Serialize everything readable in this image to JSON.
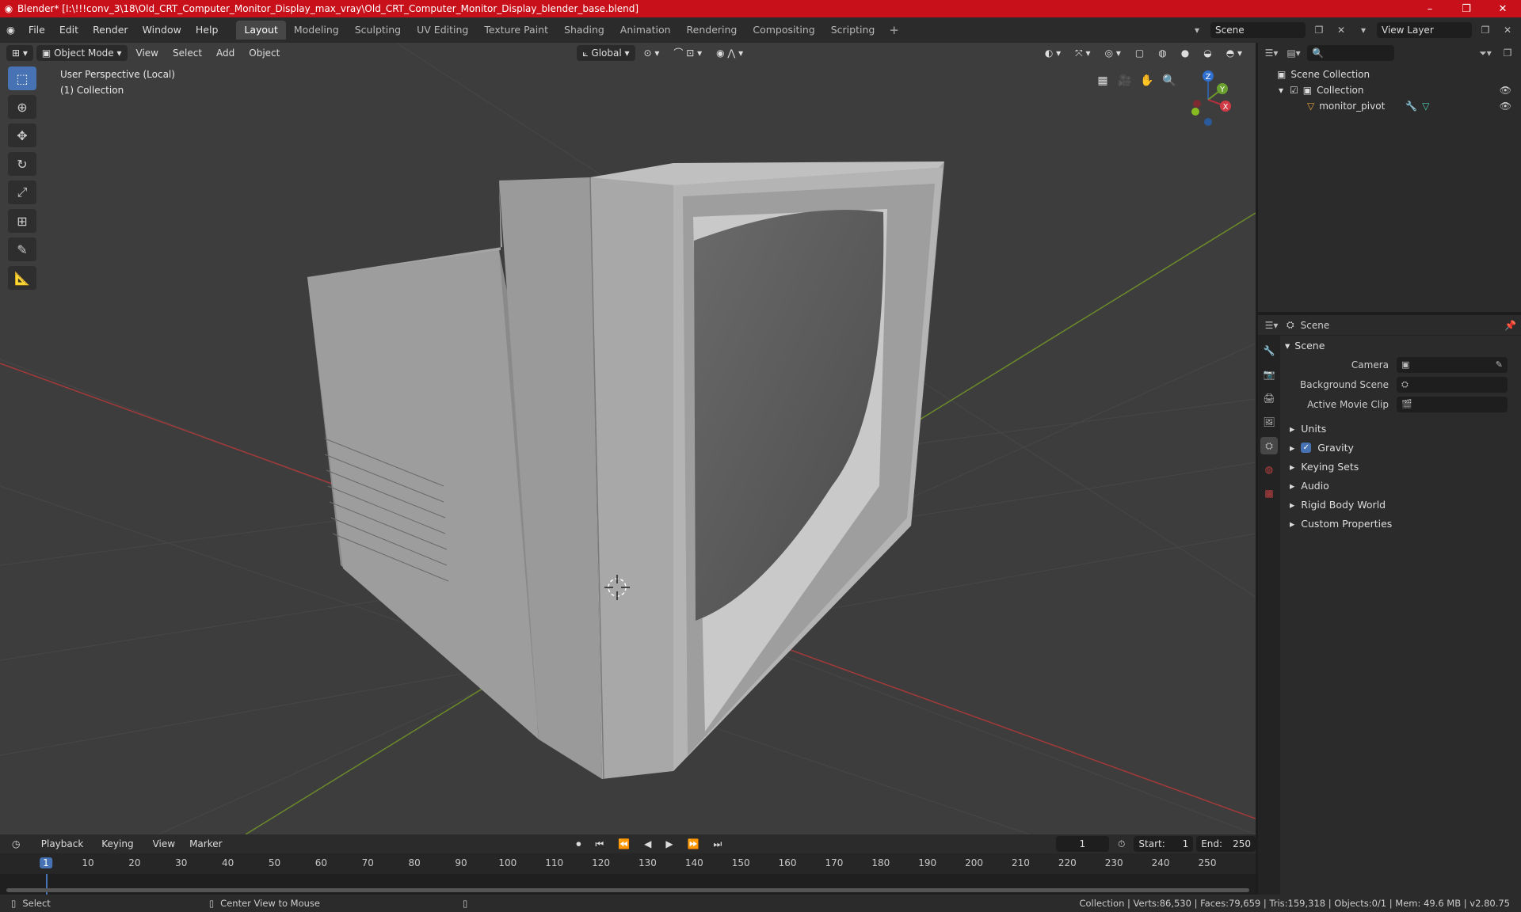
{
  "window": {
    "title": "Blender* [I:\\!!!conv_3\\18\\Old_CRT_Computer_Monitor_Display_max_vray\\Old_CRT_Computer_Monitor_Display_blender_base.blend]",
    "minimize": "–",
    "maximize": "❐",
    "close": "✕"
  },
  "menu": [
    "File",
    "Edit",
    "Render",
    "Window",
    "Help"
  ],
  "workspaces": [
    "Layout",
    "Modeling",
    "Sculpting",
    "UV Editing",
    "Texture Paint",
    "Shading",
    "Animation",
    "Rendering",
    "Compositing",
    "Scripting"
  ],
  "active_workspace": "Layout",
  "scene_field": "Scene",
  "view_layer_field": "View Layer",
  "viewport": {
    "mode": "Object Mode",
    "menus": [
      "View",
      "Select",
      "Add",
      "Object"
    ],
    "orientation": "Global",
    "info_line1": "User Perspective (Local)",
    "info_line2": "(1) Collection",
    "gizmo": {
      "z": "Z",
      "y": "Y",
      "x": "X"
    }
  },
  "outliner": {
    "search_placeholder": "",
    "root": "Scene Collection",
    "collection": "Collection",
    "object": "monitor_pivot"
  },
  "properties": {
    "header": "Scene",
    "panel": "Scene",
    "camera_label": "Camera",
    "background_scene_label": "Background Scene",
    "active_movie_clip_label": "Active Movie Clip",
    "subpanels": [
      "Units",
      "Gravity",
      "Keying Sets",
      "Audio",
      "Rigid Body World",
      "Custom Properties"
    ]
  },
  "timeline": {
    "menus": [
      "Playback",
      "Keying",
      "View",
      "Marker"
    ],
    "current_frame": "1",
    "start_label": "Start:",
    "start": "1",
    "end_label": "End:",
    "end": "250",
    "ticks": [
      "1",
      "10",
      "20",
      "30",
      "40",
      "50",
      "60",
      "70",
      "80",
      "90",
      "100",
      "110",
      "120",
      "130",
      "140",
      "150",
      "160",
      "170",
      "180",
      "190",
      "200",
      "210",
      "220",
      "230",
      "240",
      "250"
    ]
  },
  "status": {
    "left": "Select",
    "middle": "Center View to Mouse",
    "right": "Collection | Verts:86,530 | Faces:79,659 | Tris:159,318 | Objects:0/1 | Mem: 49.6 MB | v2.80.75"
  }
}
